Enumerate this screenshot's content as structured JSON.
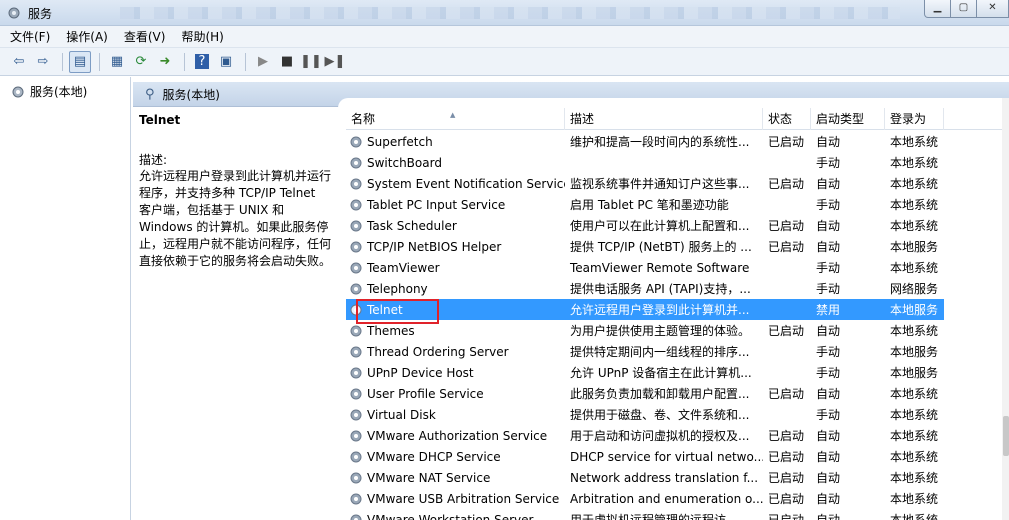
{
  "window": {
    "title": "服务"
  },
  "menu": [
    "文件(F)",
    "操作(A)",
    "查看(V)",
    "帮助(H)"
  ],
  "toolbar_icons": [
    "back-arrow-icon",
    "forward-arrow-icon",
    "show-tree-icon",
    "properties-icon",
    "refresh-icon",
    "export-icon",
    "help-icon",
    "details-icon",
    "play-icon",
    "stop-icon",
    "pause-icon",
    "restart-icon"
  ],
  "tree": {
    "root": "服务(本地)"
  },
  "pane": {
    "title": "服务(本地)"
  },
  "details": {
    "service_name": "Telnet",
    "desc_label": "描述:",
    "desc_text": "允许远程用户登录到此计算机并运行程序，并支持多种 TCP/IP Telnet 客户端，包括基于 UNIX 和 Windows 的计算机。如果此服务停止，远程用户就不能访问程序，任何直接依赖于它的服务将会启动失败。"
  },
  "columns": [
    "名称",
    "描述",
    "状态",
    "启动类型",
    "登录为"
  ],
  "rows": [
    {
      "name": "Superfetch",
      "desc": "维护和提高一段时间内的系统性...",
      "state": "已启动",
      "start": "自动",
      "logon": "本地系统"
    },
    {
      "name": "SwitchBoard",
      "desc": "",
      "state": "",
      "start": "手动",
      "logon": "本地系统"
    },
    {
      "name": "System Event Notification Service",
      "desc": "监视系统事件并通知订户这些事...",
      "state": "已启动",
      "start": "自动",
      "logon": "本地系统"
    },
    {
      "name": "Tablet PC Input Service",
      "desc": "启用 Tablet PC 笔和墨迹功能",
      "state": "",
      "start": "手动",
      "logon": "本地系统"
    },
    {
      "name": "Task Scheduler",
      "desc": "使用户可以在此计算机上配置和...",
      "state": "已启动",
      "start": "自动",
      "logon": "本地系统"
    },
    {
      "name": "TCP/IP NetBIOS Helper",
      "desc": "提供 TCP/IP (NetBT) 服务上的 ...",
      "state": "已启动",
      "start": "自动",
      "logon": "本地服务"
    },
    {
      "name": "TeamViewer",
      "desc": "TeamViewer Remote Software",
      "state": "",
      "start": "手动",
      "logon": "本地系统"
    },
    {
      "name": "Telephony",
      "desc": "提供电话服务 API (TAPI)支持，...",
      "state": "",
      "start": "手动",
      "logon": "网络服务"
    },
    {
      "name": "Telnet",
      "desc": "允许远程用户登录到此计算机并...",
      "state": "",
      "start": "禁用",
      "logon": "本地服务",
      "selected": true
    },
    {
      "name": "Themes",
      "desc": "为用户提供使用主题管理的体验。",
      "state": "已启动",
      "start": "自动",
      "logon": "本地系统"
    },
    {
      "name": "Thread Ordering Server",
      "desc": "提供特定期间内一组线程的排序...",
      "state": "",
      "start": "手动",
      "logon": "本地服务"
    },
    {
      "name": "UPnP Device Host",
      "desc": "允许 UPnP 设备宿主在此计算机...",
      "state": "",
      "start": "手动",
      "logon": "本地服务"
    },
    {
      "name": "User Profile Service",
      "desc": "此服务负责加载和卸载用户配置...",
      "state": "已启动",
      "start": "自动",
      "logon": "本地系统"
    },
    {
      "name": "Virtual Disk",
      "desc": "提供用于磁盘、卷、文件系统和...",
      "state": "",
      "start": "手动",
      "logon": "本地系统"
    },
    {
      "name": "VMware Authorization Service",
      "desc": "用于启动和访问虚拟机的授权及...",
      "state": "已启动",
      "start": "自动",
      "logon": "本地系统"
    },
    {
      "name": "VMware DHCP Service",
      "desc": "DHCP service for virtual netwo...",
      "state": "已启动",
      "start": "自动",
      "logon": "本地系统"
    },
    {
      "name": "VMware NAT Service",
      "desc": "Network address translation f...",
      "state": "已启动",
      "start": "自动",
      "logon": "本地系统"
    },
    {
      "name": "VMware USB Arbitration Service",
      "desc": "Arbitration and enumeration o...",
      "state": "已启动",
      "start": "自动",
      "logon": "本地系统"
    },
    {
      "name": "VMware Workstation Server",
      "desc": "用于虚拟机远程管理的远程访...",
      "state": "已启动",
      "start": "自动",
      "logon": "本地系统"
    }
  ]
}
